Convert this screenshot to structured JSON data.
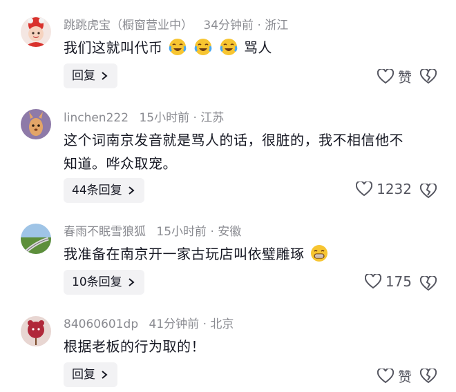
{
  "comments": [
    {
      "username": "跳跳虎宝（橱窗营业中）",
      "time": "34分钟前",
      "location": "浙江",
      "text": "我们这就叫代币",
      "text_after": "骂人",
      "emojis": [
        "laugh-cry-emoji",
        "laugh-cry-emoji",
        "laugh-cry-emoji"
      ],
      "reply_label": "回复",
      "like_label": "赞"
    },
    {
      "username": "linchen222",
      "time": "15小时前",
      "location": "江苏",
      "text_line1": "这个词南京发音就是骂人的话，很脏的，我不相信他不",
      "text_line2": "知道。哗众取宠。",
      "reply_label": "44条回复",
      "like_label": "1232"
    },
    {
      "username": "春雨不眠雪狼狐",
      "time": "15小时前",
      "location": "安徽",
      "text": "我准备在南京开一家古玩店叫依璧雕琢",
      "emojis": [
        "grin-emoji"
      ],
      "reply_label": "10条回复",
      "like_label": "175"
    },
    {
      "username": "84060601dp",
      "time": "41分钟前",
      "location": "北京",
      "text": "根据老板的行为取的！",
      "reply_label": "回复",
      "like_label": "赞"
    }
  ],
  "separator": "·",
  "colors": {
    "meta": "#8a8b91",
    "text": "#161823",
    "reply_bg": "#f2f2f4",
    "emoji": "#f7c531"
  }
}
